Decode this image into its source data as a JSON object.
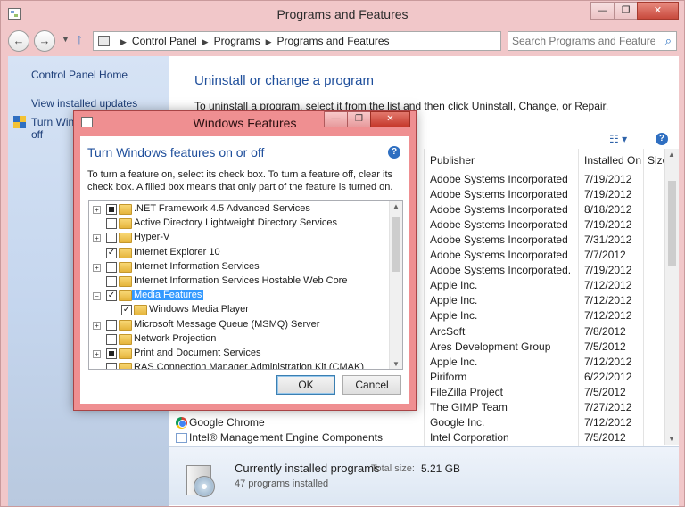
{
  "window": {
    "title": "Programs and Features",
    "caption": {
      "minimize": "—",
      "maximize": "❐",
      "close": "✕"
    }
  },
  "nav": {
    "back": "←",
    "forward": "→",
    "up": "↑",
    "breadcrumb": [
      "Control Panel",
      "Programs",
      "Programs and Features"
    ],
    "refresh": "↻",
    "search_placeholder": "Search Programs and Features"
  },
  "left_pane": {
    "links": [
      "Control Panel Home",
      "View installed updates"
    ],
    "features_link_line1": "Turn Windows features on or",
    "features_link_line2": "off"
  },
  "content": {
    "heading": "Uninstall or change a program",
    "instructions": "To uninstall a program, select it from the list and then click Uninstall, Change, or Repair.",
    "columns": {
      "publisher": "Publisher",
      "installed_on": "Installed On",
      "size": "Size"
    },
    "rows": [
      {
        "name": "",
        "publisher": "Adobe Systems Incorporated",
        "date": "7/19/2012"
      },
      {
        "name": "",
        "publisher": "Adobe Systems Incorporated",
        "date": "7/19/2012"
      },
      {
        "name": "",
        "publisher": "Adobe Systems Incorporated",
        "date": "8/18/2012"
      },
      {
        "name": "",
        "publisher": "Adobe Systems Incorporated",
        "date": "7/19/2012"
      },
      {
        "name": "",
        "publisher": "Adobe Systems Incorporated",
        "date": "7/31/2012"
      },
      {
        "name": "",
        "publisher": "Adobe Systems Incorporated",
        "date": "7/7/2012"
      },
      {
        "name": "",
        "publisher": "Adobe Systems Incorporated.",
        "date": "7/19/2012"
      },
      {
        "name": "",
        "publisher": "Apple Inc.",
        "date": "7/12/2012"
      },
      {
        "name": "",
        "publisher": "Apple Inc.",
        "date": "7/12/2012"
      },
      {
        "name": "",
        "publisher": "Apple Inc.",
        "date": "7/12/2012"
      },
      {
        "name": "",
        "publisher": "ArcSoft",
        "date": "7/8/2012"
      },
      {
        "name": "",
        "publisher": "Ares Development Group",
        "date": "7/5/2012"
      },
      {
        "name": "",
        "publisher": "Apple Inc.",
        "date": "7/12/2012"
      },
      {
        "name": "",
        "publisher": "Piriform",
        "date": "6/22/2012"
      },
      {
        "name": "",
        "publisher": "FileZilla Project",
        "date": "7/5/2012"
      },
      {
        "name": "",
        "publisher": "The GIMP Team",
        "date": "7/27/2012"
      },
      {
        "name": "Google Chrome",
        "publisher": "Google Inc.",
        "date": "7/12/2012"
      },
      {
        "name": "Intel® Management Engine Components",
        "publisher": "Intel Corporation",
        "date": "7/5/2012"
      }
    ]
  },
  "footer": {
    "title": "Currently installed programs",
    "total_size_label": "Total size:",
    "total_size": "5.21 GB",
    "count": "47 programs installed"
  },
  "dialog": {
    "title": "Windows Features",
    "caption": {
      "minimize": "—",
      "maximize": "❐",
      "close": "✕"
    },
    "heading": "Turn Windows features on or off",
    "description": "To turn a feature on, select its check box. To turn a feature off, clear its check box. A filled box means that only part of the feature is turned on.",
    "features": [
      {
        "label": ".NET Framework 4.5 Advanced Services",
        "expandable": true,
        "state": "partial",
        "indent": 0
      },
      {
        "label": "Active Directory Lightweight Directory Services",
        "expandable": false,
        "state": "off",
        "indent": 0
      },
      {
        "label": "Hyper-V",
        "expandable": true,
        "state": "off",
        "indent": 0
      },
      {
        "label": "Internet Explorer 10",
        "expandable": false,
        "state": "on",
        "indent": 0
      },
      {
        "label": "Internet Information Services",
        "expandable": true,
        "state": "off",
        "indent": 0
      },
      {
        "label": "Internet Information Services Hostable Web Core",
        "expandable": false,
        "state": "off",
        "indent": 0
      },
      {
        "label": "Media Features",
        "expandable": true,
        "expanded": true,
        "state": "on",
        "indent": 0,
        "selected": true
      },
      {
        "label": "Windows Media Player",
        "expandable": false,
        "state": "on",
        "indent": 1
      },
      {
        "label": "Microsoft Message Queue (MSMQ) Server",
        "expandable": true,
        "state": "off",
        "indent": 0
      },
      {
        "label": "Network Projection",
        "expandable": false,
        "state": "off",
        "indent": 0
      },
      {
        "label": "Print and Document Services",
        "expandable": true,
        "state": "partial",
        "indent": 0
      },
      {
        "label": "RAS Connection Manager Administration Kit (CMAK)",
        "expandable": false,
        "state": "off",
        "indent": 0
      }
    ],
    "ok": "OK",
    "cancel": "Cancel"
  },
  "colors": {
    "window_frame": "#f1c7c9",
    "dialog_frame": "#ef8f91",
    "heading_blue": "#1e4e9b",
    "selection": "#3399ff"
  }
}
